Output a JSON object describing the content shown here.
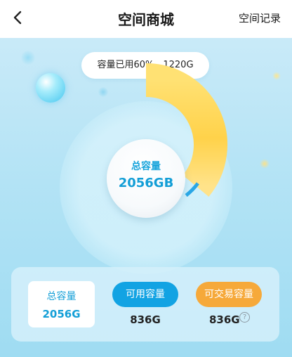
{
  "header": {
    "title": "空间商城",
    "record_link": "空间记录",
    "back_icon": "chevron-left-icon"
  },
  "usage": {
    "text": "容量已用60%，1220G",
    "used_fraction": 0.6
  },
  "donut": {
    "center_label": "总容量",
    "center_value": "2056GB",
    "used_color": "#ffd54f",
    "marker_color": "#2aa7e6"
  },
  "stats": {
    "total": {
      "label": "总容量",
      "value": "2056G"
    },
    "available": {
      "label": "可用容量",
      "value": "836G",
      "color": "#12a3e3"
    },
    "tradeable": {
      "label": "可交易容量",
      "value": "836G",
      "color": "#f6a93a",
      "help_icon": "question-circle-icon"
    }
  }
}
